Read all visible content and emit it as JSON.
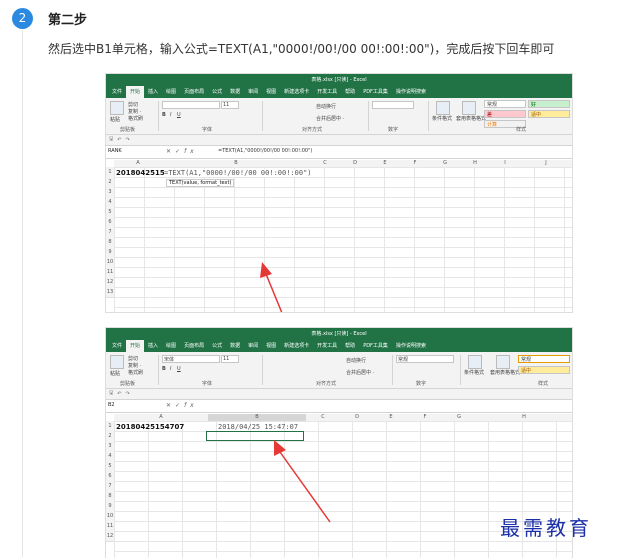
{
  "step": {
    "number": "2",
    "title": "第二步",
    "instruction": "然后选中B1单元格，输入公式=TEXT(A1,\"0000!/00!/00 00!:00!:00\")，完成后按下回车即可"
  },
  "screenshot1": {
    "titlebar": "表格.xlsx [只读] - Excel",
    "menu": [
      "文件",
      "开始",
      "插入",
      "绘图",
      "页面布局",
      "公式",
      "数据",
      "审阅",
      "视图",
      "新建选项卡",
      "开发工具",
      "帮助",
      "PDF工具集",
      "操作说明搜索"
    ],
    "active_menu": "开始",
    "ribbon": {
      "clipboard": [
        "剪切",
        "复制 ·",
        "格式刷"
      ],
      "paste": "粘贴",
      "groups": [
        "剪贴板",
        "字体",
        "对齐方式",
        "数字",
        "样式"
      ],
      "font_size": "11",
      "merge": "合并后居中 ·",
      "wrap": "自动换行",
      "cond_format": "条件格式",
      "table_format": "套用表格格式",
      "style_normal": "常规",
      "style_good": "好",
      "style_bad": "差",
      "style_suitable": "适中",
      "style_calc": "计算"
    },
    "namebox": "RANK",
    "formula": "=TEXT(A1,\"0000!/00!/00 00!:00!:00\")",
    "columns": [
      "A",
      "B",
      "C",
      "D",
      "E",
      "F",
      "G",
      "H",
      "I",
      "J"
    ],
    "rows": [
      "1",
      "2",
      "3",
      "4",
      "5",
      "6",
      "7",
      "8",
      "9",
      "10",
      "11",
      "12",
      "13"
    ],
    "a1": "201804251547",
    "b1": "=TEXT(A1,\"0000!/00!/00 00!:00!:00\")",
    "tooltip": "TEXT(value, format_text)"
  },
  "screenshot2": {
    "titlebar": "表格.xlsx [只读] - Excel",
    "menu": [
      "文件",
      "开始",
      "插入",
      "绘图",
      "页面布局",
      "公式",
      "数据",
      "审阅",
      "视图",
      "新建选项卡",
      "开发工具",
      "帮助",
      "PDF工具集",
      "操作说明搜索"
    ],
    "active_menu": "开始",
    "ribbon": {
      "font": "宋体",
      "font_size": "11",
      "clipboard": [
        "剪切",
        "复制 ·",
        "格式刷"
      ],
      "paste": "粘贴",
      "groups": [
        "剪贴板",
        "字体",
        "对齐方式",
        "数字",
        "样式"
      ],
      "wrap": "自动换行",
      "merge": "合并后居中 ·",
      "number_format": "常规",
      "cond_format": "条件格式",
      "table_format": "套用表格格式",
      "style_normal": "常规",
      "style_suitable": "适中"
    },
    "namebox": "B2",
    "columns": [
      "A",
      "B",
      "C",
      "D",
      "E",
      "F",
      "G",
      "H"
    ],
    "rows": [
      "1",
      "2",
      "3",
      "4",
      "5",
      "6",
      "7",
      "8",
      "9",
      "10",
      "11",
      "12"
    ],
    "a1": "20180425154707",
    "b1": "2018/04/25 15:47:07"
  },
  "watermark": "最需教育",
  "colors": {
    "excel_green": "#217346",
    "badge_blue": "#2b8ae0",
    "arrow_red": "#e53935",
    "watermark_blue": "#1a2fa8"
  }
}
